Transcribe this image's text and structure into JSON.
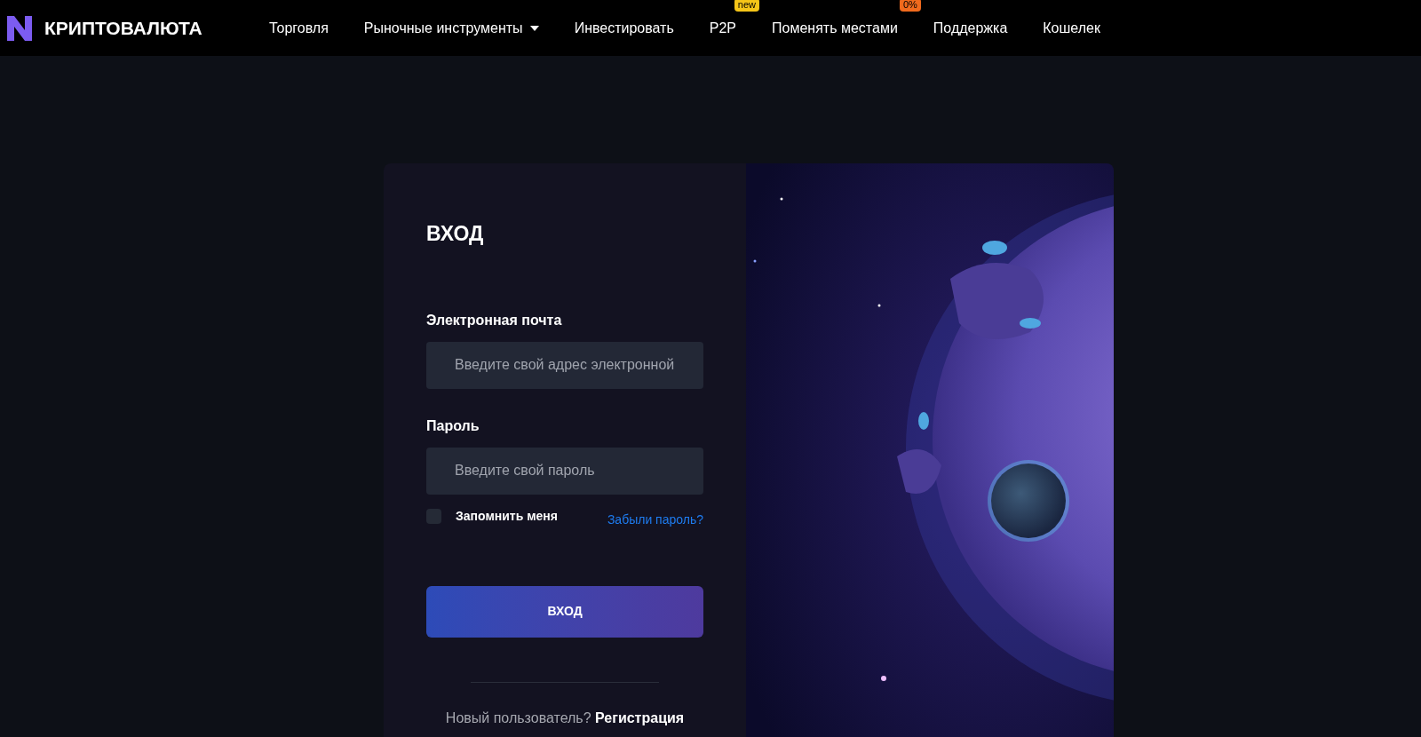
{
  "brand": {
    "name": "КРИПТОВАЛЮТА"
  },
  "nav": {
    "items": [
      {
        "label": "Торговля",
        "dropdown": false
      },
      {
        "label": "Рыночные инструменты",
        "dropdown": true
      },
      {
        "label": "Инвестировать",
        "dropdown": false
      },
      {
        "label": "P2P",
        "dropdown": false,
        "badge": {
          "text": "new",
          "color": "#f5c518"
        }
      },
      {
        "label": "Поменять местами",
        "dropdown": false,
        "badge": {
          "text": "0%",
          "color": "#f06a1d"
        }
      },
      {
        "label": "Поддержка",
        "dropdown": false
      },
      {
        "label": "Кошелек",
        "dropdown": false
      }
    ]
  },
  "login": {
    "title": "ВХОД",
    "fields": [
      {
        "label": "Электронная почта",
        "placeholder": "Введите свой адрес электронной"
      },
      {
        "label": "Пароль",
        "placeholder": "Введите свой пароль"
      }
    ],
    "remember": {
      "label": "Запомнить меня",
      "checked": false
    },
    "forgot": "Забыли пароль?",
    "submit": "ВХОД",
    "footer": {
      "text": "Новый пользователь?",
      "link": "Регистрация"
    }
  }
}
